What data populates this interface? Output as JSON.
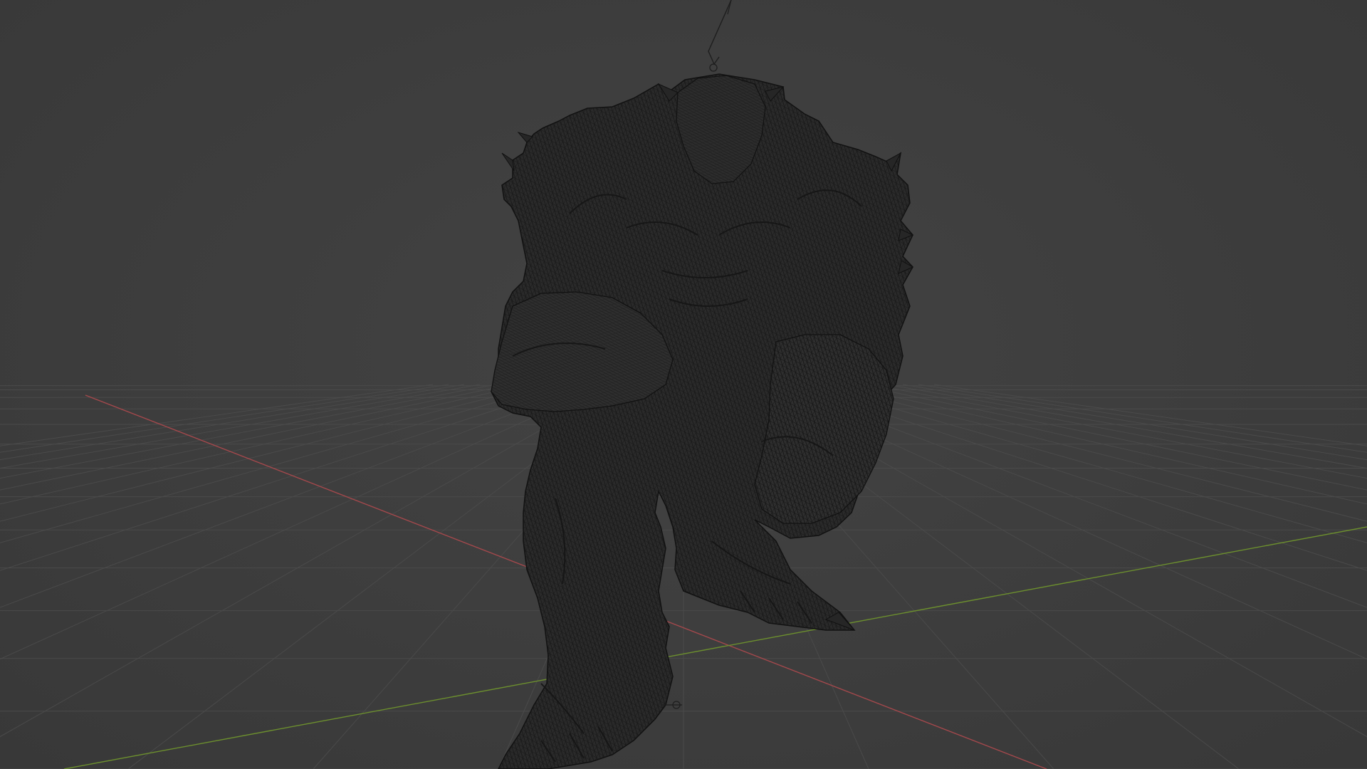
{
  "viewport": {
    "background_color": "#3d3d3d",
    "grid_color": "#4a4a4a",
    "x_axis_color": "#a3484c",
    "y_axis_color": "#6c8f2e",
    "mesh_fill_color": "#2b2b2b",
    "mesh_wire_color": "#141414",
    "overlay_line_color": "#1e1e1e"
  },
  "objects": {
    "mesh": {
      "kind": "wireframe-creature-mesh"
    },
    "light": {
      "kind": "light-gizmo"
    },
    "origin": {
      "kind": "object-origin-marker"
    }
  }
}
